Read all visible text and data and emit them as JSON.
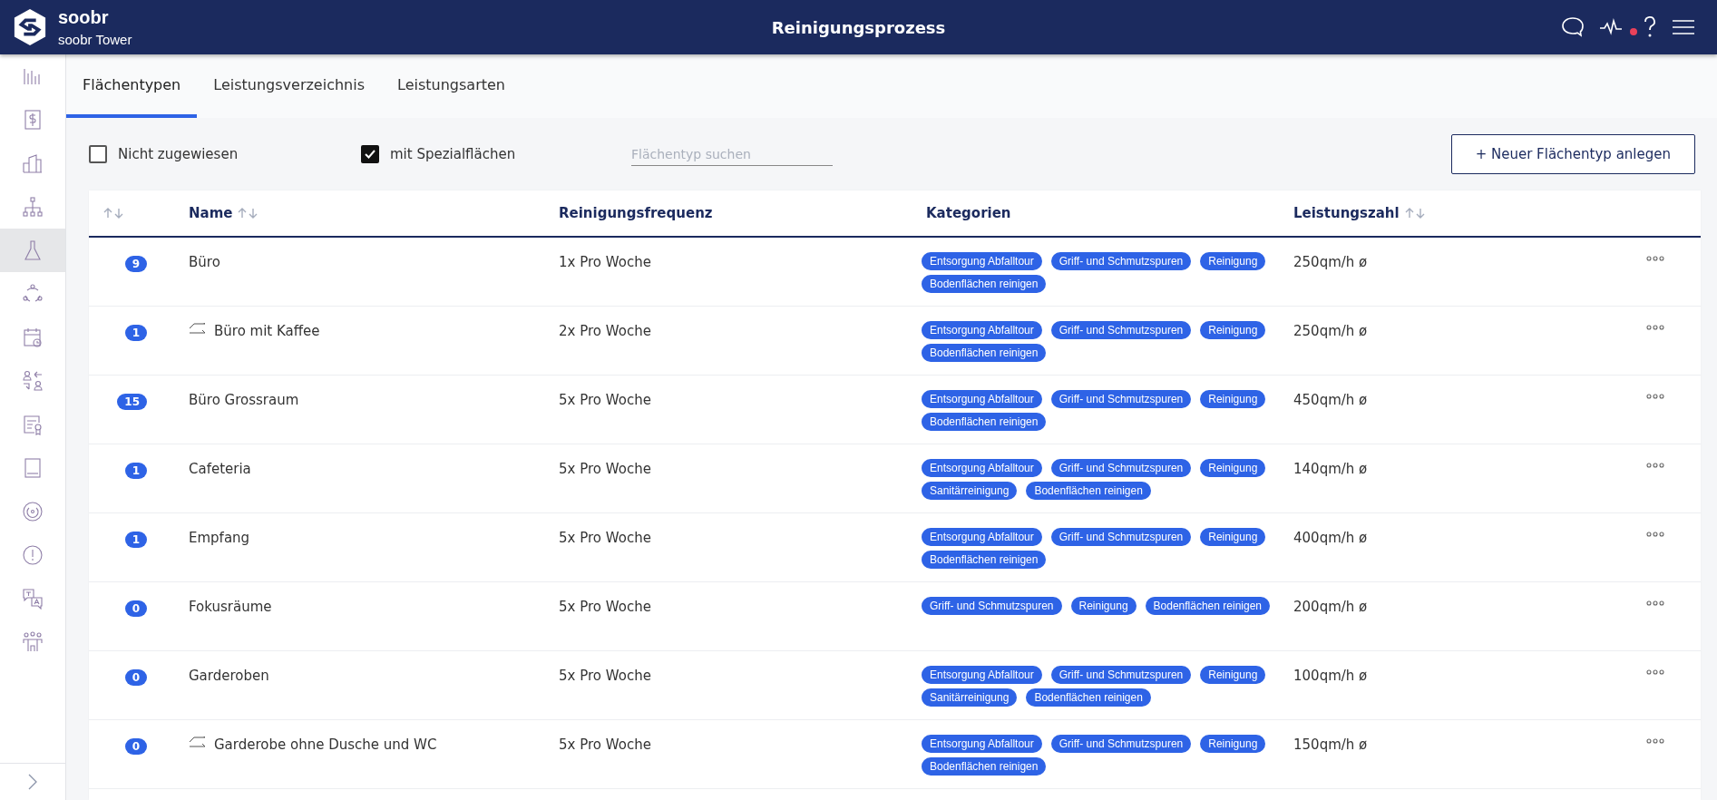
{
  "header": {
    "brand": "soobr",
    "site": "soobr Tower",
    "title": "Reinigungsprozess",
    "notification_dot": true
  },
  "sidebar": {
    "items": [
      {
        "selected": false
      },
      {
        "selected": false
      },
      {
        "selected": false
      },
      {
        "selected": false
      },
      {
        "selected": true
      },
      {
        "selected": false
      },
      {
        "selected": false
      },
      {
        "selected": false
      },
      {
        "selected": false
      },
      {
        "selected": false
      },
      {
        "selected": false
      },
      {
        "selected": false
      },
      {
        "selected": false
      },
      {
        "selected": false
      }
    ]
  },
  "tabs": [
    {
      "label": "Flächentypen",
      "selected": true
    },
    {
      "label": "Leistungsverzeichnis",
      "selected": false
    },
    {
      "label": "Leistungsarten",
      "selected": false
    }
  ],
  "filters": [
    {
      "label": "Nicht zugewiesen",
      "checked": false
    },
    {
      "label": "mit Spezialflächen",
      "checked": true
    }
  ],
  "search": {
    "placeholder": "Flächentyp suchen"
  },
  "new_button": "+ Neuer Flächentyp anlegen",
  "table": {
    "columns": [
      {
        "sortable": true
      },
      {
        "label": "Name",
        "sortable": true
      },
      {
        "label": "Reinigungsfrequenz",
        "sortable": false
      },
      {
        "label": "Kategorien",
        "sortable": false
      },
      {
        "label": "Leistungszahl",
        "sortable": true
      }
    ],
    "rows": [
      {
        "count": "9",
        "name": "Büro",
        "special": false,
        "frequency": "1x Pro Woche",
        "categories": [
          "Entsorgung Abfalltour",
          "Griff- und Schmutzspuren",
          "Reinigung",
          "Bodenflächen reinigen"
        ],
        "performance": "250qm/h ø"
      },
      {
        "count": "1",
        "name": "Büro mit Kaffee",
        "special": true,
        "frequency": "2x Pro Woche",
        "categories": [
          "Entsorgung Abfalltour",
          "Griff- und Schmutzspuren",
          "Reinigung",
          "Bodenflächen reinigen"
        ],
        "performance": "250qm/h ø"
      },
      {
        "count": "15",
        "name": "Büro Grossraum",
        "special": false,
        "frequency": "5x Pro Woche",
        "categories": [
          "Entsorgung Abfalltour",
          "Griff- und Schmutzspuren",
          "Reinigung",
          "Bodenflächen reinigen"
        ],
        "performance": "450qm/h ø"
      },
      {
        "count": "1",
        "name": "Cafeteria",
        "special": false,
        "frequency": "5x Pro Woche",
        "categories": [
          "Entsorgung Abfalltour",
          "Griff- und Schmutzspuren",
          "Reinigung",
          "Sanitärreinigung",
          "Bodenflächen reinigen"
        ],
        "performance": "140qm/h ø"
      },
      {
        "count": "1",
        "name": "Empfang",
        "special": false,
        "frequency": "5x Pro Woche",
        "categories": [
          "Entsorgung Abfalltour",
          "Griff- und Schmutzspuren",
          "Reinigung",
          "Bodenflächen reinigen"
        ],
        "performance": "400qm/h ø"
      },
      {
        "count": "0",
        "name": "Fokusräume",
        "special": false,
        "frequency": "5x Pro Woche",
        "categories": [
          "Griff- und Schmutzspuren",
          "Reinigung",
          "Bodenflächen reinigen"
        ],
        "performance": "200qm/h ø"
      },
      {
        "count": "0",
        "name": "Garderoben",
        "special": false,
        "frequency": "5x Pro Woche",
        "categories": [
          "Entsorgung Abfalltour",
          "Griff- und Schmutzspuren",
          "Reinigung",
          "Sanitärreinigung",
          "Bodenflächen reinigen"
        ],
        "performance": "100qm/h ø"
      },
      {
        "count": "0",
        "name": "Garderobe ohne Dusche und WC",
        "special": true,
        "frequency": "5x Pro Woche",
        "categories": [
          "Entsorgung Abfalltour",
          "Griff- und Schmutzspuren",
          "Reinigung",
          "Bodenflächen reinigen"
        ],
        "performance": "150qm/h ø"
      }
    ]
  }
}
